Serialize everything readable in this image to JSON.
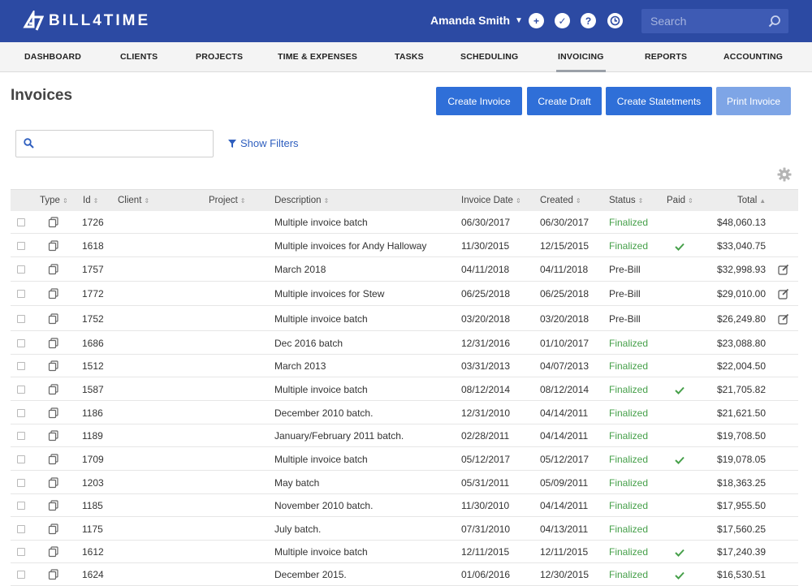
{
  "header": {
    "logo_text": "BILL4TIME",
    "user_name": "Amanda Smith",
    "search_placeholder": "Search",
    "icons": [
      "plus-icon",
      "check-icon",
      "help-icon",
      "clock-icon",
      "search-icon"
    ],
    "brand_color": "#2c4aa3"
  },
  "nav": {
    "items": [
      "DASHBOARD",
      "CLIENTS",
      "PROJECTS",
      "TIME & EXPENSES",
      "TASKS",
      "SCHEDULING",
      "INVOICING",
      "REPORTS",
      "ACCOUNTING"
    ],
    "active": "INVOICING"
  },
  "page": {
    "title": "Invoices",
    "buttons": {
      "create_invoice": "Create Invoice",
      "create_draft": "Create Draft",
      "create_statements": "Create Statetments",
      "print_invoice": "Print Invoice"
    },
    "show_filters": "Show Filters"
  },
  "table": {
    "columns": [
      "Type",
      "Id",
      "Client",
      "Project",
      "Description",
      "Invoice Date",
      "Created",
      "Status",
      "Paid",
      "Total"
    ],
    "sort_column": "Total",
    "rows": [
      {
        "id": "1726",
        "description": "Multiple invoice batch",
        "invoice_date": "06/30/2017",
        "created": "06/30/2017",
        "status": "Finalized",
        "paid": false,
        "total": "$48,060.13",
        "editable": false
      },
      {
        "id": "1618",
        "description": "Multiple invoices for Andy Halloway",
        "invoice_date": "11/30/2015",
        "created": "12/15/2015",
        "status": "Finalized",
        "paid": true,
        "total": "$33,040.75",
        "editable": false
      },
      {
        "id": "1757",
        "description": "March 2018",
        "invoice_date": "04/11/2018",
        "created": "04/11/2018",
        "status": "Pre-Bill",
        "paid": false,
        "total": "$32,998.93",
        "editable": true
      },
      {
        "id": "1772",
        "description": "Multiple invoices for Stew",
        "invoice_date": "06/25/2018",
        "created": "06/25/2018",
        "status": "Pre-Bill",
        "paid": false,
        "total": "$29,010.00",
        "editable": true
      },
      {
        "id": "1752",
        "description": "Multiple invoice batch",
        "invoice_date": "03/20/2018",
        "created": "03/20/2018",
        "status": "Pre-Bill",
        "paid": false,
        "total": "$26,249.80",
        "editable": true
      },
      {
        "id": "1686",
        "description": "Dec 2016 batch",
        "invoice_date": "12/31/2016",
        "created": "01/10/2017",
        "status": "Finalized",
        "paid": false,
        "total": "$23,088.80",
        "editable": false
      },
      {
        "id": "1512",
        "description": "March 2013",
        "invoice_date": "03/31/2013",
        "created": "04/07/2013",
        "status": "Finalized",
        "paid": false,
        "total": "$22,004.50",
        "editable": false
      },
      {
        "id": "1587",
        "description": "Multiple invoice batch",
        "invoice_date": "08/12/2014",
        "created": "08/12/2014",
        "status": "Finalized",
        "paid": true,
        "total": "$21,705.82",
        "editable": false
      },
      {
        "id": "1186",
        "description": "December 2010 batch.",
        "invoice_date": "12/31/2010",
        "created": "04/14/2011",
        "status": "Finalized",
        "paid": false,
        "total": "$21,621.50",
        "editable": false
      },
      {
        "id": "1189",
        "description": "January/February 2011 batch.",
        "invoice_date": "02/28/2011",
        "created": "04/14/2011",
        "status": "Finalized",
        "paid": false,
        "total": "$19,708.50",
        "editable": false
      },
      {
        "id": "1709",
        "description": "Multiple invoice batch",
        "invoice_date": "05/12/2017",
        "created": "05/12/2017",
        "status": "Finalized",
        "paid": true,
        "total": "$19,078.05",
        "editable": false
      },
      {
        "id": "1203",
        "description": "May batch",
        "invoice_date": "05/31/2011",
        "created": "05/09/2011",
        "status": "Finalized",
        "paid": false,
        "total": "$18,363.25",
        "editable": false
      },
      {
        "id": "1185",
        "description": "November 2010 batch.",
        "invoice_date": "11/30/2010",
        "created": "04/14/2011",
        "status": "Finalized",
        "paid": false,
        "total": "$17,955.50",
        "editable": false
      },
      {
        "id": "1175",
        "description": "July batch.",
        "invoice_date": "07/31/2010",
        "created": "04/13/2011",
        "status": "Finalized",
        "paid": false,
        "total": "$17,560.25",
        "editable": false
      },
      {
        "id": "1612",
        "description": "Multiple invoice batch",
        "invoice_date": "12/11/2015",
        "created": "12/11/2015",
        "status": "Finalized",
        "paid": true,
        "total": "$17,240.39",
        "editable": false
      },
      {
        "id": "1624",
        "description": "December 2015.",
        "invoice_date": "01/06/2016",
        "created": "12/30/2015",
        "status": "Finalized",
        "paid": true,
        "total": "$16,530.51",
        "editable": false
      }
    ]
  }
}
